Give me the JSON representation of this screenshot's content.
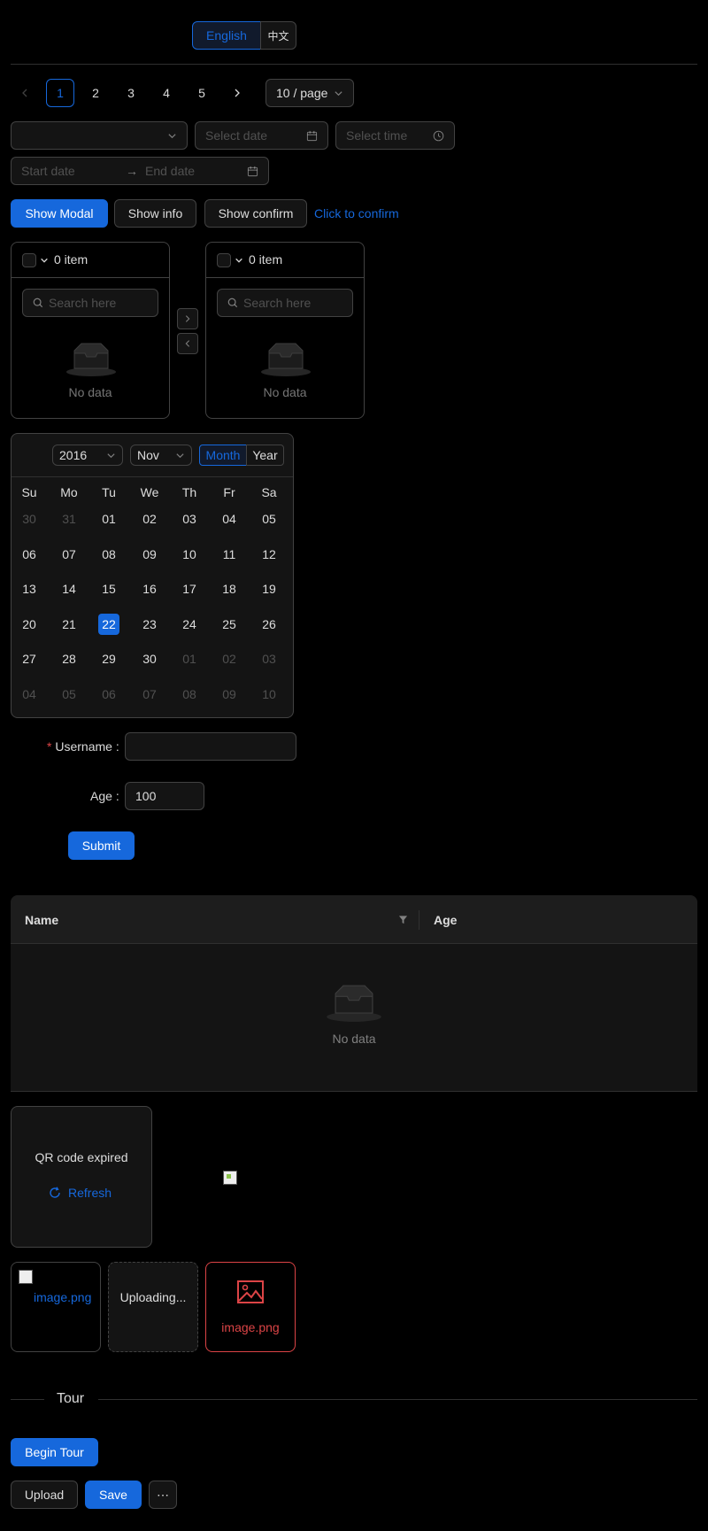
{
  "locale": {
    "english_label": "English",
    "alt_label": "中文"
  },
  "pagination": {
    "pages": [
      "1",
      "2",
      "3",
      "4",
      "5"
    ],
    "current": "1",
    "page_size": "10 / page"
  },
  "pickers": {
    "select_value": "",
    "date_placeholder": "Select date",
    "time_placeholder": "Select time",
    "range_start_placeholder": "Start date",
    "range_end_placeholder": "End date"
  },
  "modal_buttons": {
    "show_modal": "Show Modal",
    "show_info": "Show info",
    "show_confirm": "Show confirm",
    "click_confirm": "Click to confirm"
  },
  "transfer": {
    "left": {
      "count_label": "0 item",
      "search_placeholder": "Search here",
      "empty": "No data"
    },
    "right": {
      "count_label": "0 item",
      "search_placeholder": "Search here",
      "empty": "No data"
    }
  },
  "calendar": {
    "year": "2016",
    "month": "Nov",
    "modes": [
      "Month",
      "Year"
    ],
    "active_mode": "Month",
    "weekdays": [
      "Su",
      "Mo",
      "Tu",
      "We",
      "Th",
      "Fr",
      "Sa"
    ],
    "weeks": [
      [
        "30",
        "31",
        "01",
        "02",
        "03",
        "04",
        "05"
      ],
      [
        "06",
        "07",
        "08",
        "09",
        "10",
        "11",
        "12"
      ],
      [
        "13",
        "14",
        "15",
        "16",
        "17",
        "18",
        "19"
      ],
      [
        "20",
        "21",
        "22",
        "23",
        "24",
        "25",
        "26"
      ],
      [
        "27",
        "28",
        "29",
        "30",
        "01",
        "02",
        "03"
      ],
      [
        "04",
        "05",
        "06",
        "07",
        "08",
        "09",
        "10"
      ]
    ],
    "selected": "22"
  },
  "form": {
    "username_label": "Username",
    "username_value": "",
    "age_label": "Age",
    "age_value": "100",
    "submit_label": "Submit"
  },
  "table": {
    "columns": [
      "Name",
      "Age"
    ],
    "empty": "No data"
  },
  "qr": {
    "expired_text": "QR code expired",
    "refresh_label": "Refresh"
  },
  "upload": {
    "file1_name": "image.png",
    "uploading_text": "Uploading...",
    "file_error_name": "image.png"
  },
  "tour": {
    "divider_title": "Tour",
    "begin_label": "Begin Tour",
    "upload_label": "Upload",
    "save_label": "Save",
    "more_label": "⋯"
  },
  "colors": {
    "primary": "#1668dc",
    "error": "#dc4446",
    "border": "#424242",
    "surface": "#141414"
  }
}
